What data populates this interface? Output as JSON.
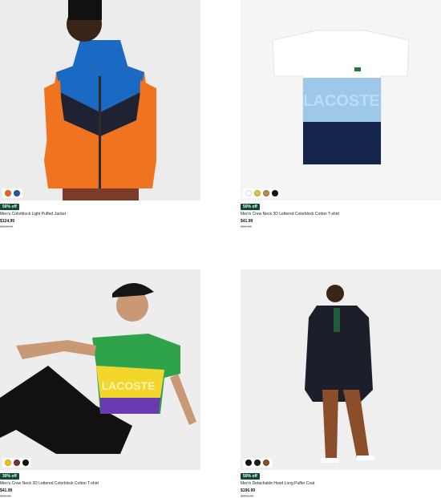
{
  "products": [
    {
      "name": "Men's Colorblock Light Puffed Jacket",
      "badge": "50% off",
      "price": "$124.99",
      "old_price": "$250.00",
      "swatches": [
        "#e8671f",
        "#1c5aa8"
      ]
    },
    {
      "name": "Men's Crew Neck 3D Lettered Colorblock Cotton T-shirt",
      "badge": "50% off",
      "price": "$41.99",
      "old_price": "$83.00",
      "swatches": [
        "#ffffff",
        "#e0c23a",
        "#b8884d",
        "#111111"
      ]
    },
    {
      "name": "Men's Crew Neck 3D Lettered Colorblock Cotton T-shirt",
      "badge": "30% off",
      "price": "$41.99",
      "old_price": "$60.00",
      "swatches": [
        "#f1c40f",
        "#7a2f2f",
        "#111111"
      ]
    },
    {
      "name": "Men's Detachable Hood Long Puffer Coat",
      "badge": "50% off",
      "price": "$196.99",
      "old_price": "$395.00",
      "swatches": [
        "#111111",
        "#1c1c1c",
        "#8a4f2a"
      ]
    }
  ]
}
